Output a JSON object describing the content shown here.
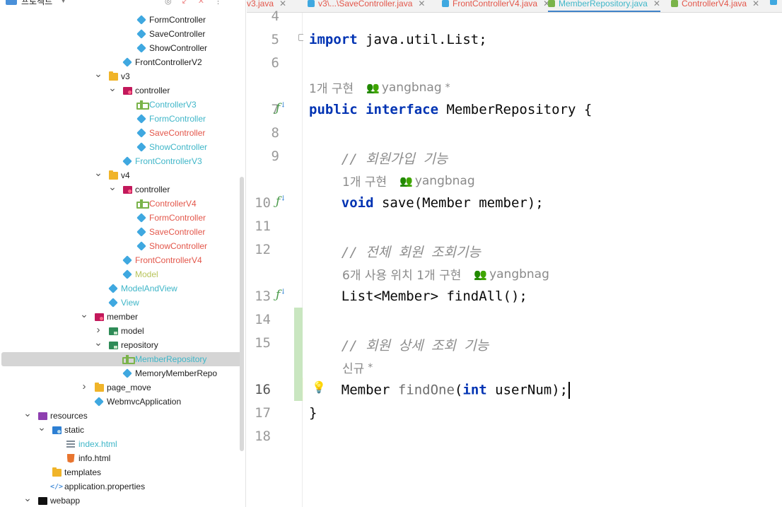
{
  "header": {
    "title": "프로젝트",
    "tools": [
      "◎",
      "↙",
      "✕",
      "⋮"
    ]
  },
  "tree": [
    {
      "label": "FormController",
      "depth": 10,
      "icon": "class",
      "color": "normal",
      "chev": ""
    },
    {
      "label": "SaveController",
      "depth": 10,
      "icon": "class",
      "color": "normal",
      "chev": ""
    },
    {
      "label": "ShowController",
      "depth": 10,
      "icon": "class",
      "color": "normal",
      "chev": ""
    },
    {
      "label": "FrontControllerV2",
      "depth": 9,
      "icon": "class",
      "color": "normal",
      "chev": ""
    },
    {
      "label": "v3",
      "depth": 8,
      "icon": "folder",
      "color": "normal",
      "chev": "open"
    },
    {
      "label": "controller",
      "depth": 9,
      "icon": "pkg-red",
      "color": "normal",
      "chev": "open"
    },
    {
      "label": "ControllerV3",
      "depth": 10,
      "icon": "interface",
      "color": "cyan",
      "chev": ""
    },
    {
      "label": "FormController",
      "depth": 10,
      "icon": "class",
      "color": "cyan",
      "chev": ""
    },
    {
      "label": "SaveController",
      "depth": 10,
      "icon": "class",
      "color": "red",
      "chev": ""
    },
    {
      "label": "ShowController",
      "depth": 10,
      "icon": "class",
      "color": "cyan",
      "chev": ""
    },
    {
      "label": "FrontControllerV3",
      "depth": 9,
      "icon": "class",
      "color": "cyan",
      "chev": ""
    },
    {
      "label": "v4",
      "depth": 8,
      "icon": "folder",
      "color": "normal",
      "chev": "open"
    },
    {
      "label": "controller",
      "depth": 9,
      "icon": "pkg-red",
      "color": "normal",
      "chev": "open"
    },
    {
      "label": "ControllerV4",
      "depth": 10,
      "icon": "interface",
      "color": "red",
      "chev": ""
    },
    {
      "label": "FormController",
      "depth": 10,
      "icon": "class",
      "color": "red",
      "chev": ""
    },
    {
      "label": "SaveController",
      "depth": 10,
      "icon": "class",
      "color": "red",
      "chev": ""
    },
    {
      "label": "ShowController",
      "depth": 10,
      "icon": "class",
      "color": "red",
      "chev": ""
    },
    {
      "label": "FrontControllerV4",
      "depth": 9,
      "icon": "class",
      "color": "red",
      "chev": ""
    },
    {
      "label": "Model",
      "depth": 9,
      "icon": "class",
      "color": "yellow",
      "chev": ""
    },
    {
      "label": "ModelAndView",
      "depth": 8,
      "icon": "class",
      "color": "cyan",
      "chev": ""
    },
    {
      "label": "View",
      "depth": 8,
      "icon": "class",
      "color": "cyan",
      "chev": ""
    },
    {
      "label": "member",
      "depth": 7,
      "icon": "pkg-red",
      "color": "normal",
      "chev": "open"
    },
    {
      "label": "model",
      "depth": 8,
      "icon": "pkg-green",
      "color": "normal",
      "chev": "closed"
    },
    {
      "label": "repository",
      "depth": 8,
      "icon": "pkg-green",
      "color": "normal",
      "chev": "open"
    },
    {
      "label": "MemberRepository",
      "depth": 9,
      "icon": "interface",
      "color": "cyan",
      "chev": "",
      "selected": true
    },
    {
      "label": "MemoryMemberRepo",
      "depth": 9,
      "icon": "class",
      "color": "normal",
      "chev": ""
    },
    {
      "label": "page_move",
      "depth": 7,
      "icon": "folder",
      "color": "normal",
      "chev": "closed"
    },
    {
      "label": "WebmvcApplication",
      "depth": 7,
      "icon": "class",
      "color": "normal",
      "chev": ""
    },
    {
      "label": "resources",
      "depth": 3,
      "icon": "pkg-purple",
      "color": "normal",
      "chev": "open"
    },
    {
      "label": "static",
      "depth": 4,
      "icon": "pkg-blue",
      "color": "normal",
      "chev": "open"
    },
    {
      "label": "index.html",
      "depth": 5,
      "icon": "html-lines",
      "color": "cyan",
      "chev": ""
    },
    {
      "label": "info.html",
      "depth": 5,
      "icon": "html5",
      "color": "normal",
      "chev": ""
    },
    {
      "label": "templates",
      "depth": 4,
      "icon": "folder",
      "color": "normal",
      "chev": ""
    },
    {
      "label": "application.properties",
      "depth": 4,
      "icon": "props",
      "color": "normal",
      "chev": ""
    },
    {
      "label": "webapp",
      "depth": 3,
      "icon": "pkg-black",
      "color": "normal",
      "chev": "open"
    }
  ],
  "tabs": [
    {
      "label": "v3.java",
      "style": "red",
      "active": false
    },
    {
      "label": "v3\\...\\SaveController.java",
      "style": "red",
      "active": false
    },
    {
      "label": "FrontControllerV4.java",
      "style": "red",
      "active": false
    },
    {
      "label": "MemberRepository.java",
      "style": "cyan",
      "active": true
    },
    {
      "label": "ControllerV4.java",
      "style": "red",
      "active": false
    }
  ],
  "editor": {
    "lines": [
      {
        "num": "4",
        "code": []
      },
      {
        "num": "5",
        "code": [
          [
            "kw",
            "import"
          ],
          [
            "",
            " java.util.List;"
          ]
        ]
      },
      {
        "num": "6",
        "code": []
      },
      {
        "num": "",
        "hint": {
          "text": "1개 구현",
          "author": "yangbnag",
          "star": "*"
        }
      },
      {
        "num": "7",
        "gutter": true,
        "code": [
          [
            "kw",
            "public interface"
          ],
          [
            "",
            " MemberRepository {"
          ]
        ]
      },
      {
        "num": "8",
        "code": []
      },
      {
        "num": "9",
        "code": [
          [
            "",
            "    "
          ],
          [
            "cmt",
            "// 회원가입 기능"
          ]
        ]
      },
      {
        "num": "",
        "hint": {
          "text": "1개 구현",
          "author": "yangbnag",
          "star": ""
        },
        "indent": true
      },
      {
        "num": "10",
        "gutter": true,
        "code": [
          [
            "",
            "    "
          ],
          [
            "kw",
            "void"
          ],
          [
            "",
            " save(Member member);"
          ]
        ]
      },
      {
        "num": "11",
        "code": []
      },
      {
        "num": "12",
        "code": [
          [
            "",
            "    "
          ],
          [
            "cmt",
            "// 전체 회원 조회기능"
          ]
        ]
      },
      {
        "num": "",
        "hint": {
          "text": "6개 사용 위치   1개 구현",
          "author": "yangbnag",
          "star": ""
        },
        "indent": true
      },
      {
        "num": "13",
        "gutter": true,
        "code": [
          [
            "",
            "    List<Member> findAll();"
          ]
        ]
      },
      {
        "num": "14",
        "code": []
      },
      {
        "num": "15",
        "code": [
          [
            "",
            "    "
          ],
          [
            "cmt",
            "// 회원 상세 조회 기능"
          ]
        ]
      },
      {
        "num": "",
        "hint": {
          "text": "신규",
          "author": "",
          "star": "*"
        },
        "indent": true
      },
      {
        "num": "16",
        "current": true,
        "code": [
          [
            "",
            "    Member "
          ],
          [
            "fn-gray",
            "findOne"
          ],
          [
            "",
            "("
          ],
          [
            "kw",
            "int"
          ],
          [
            "",
            " userNum);"
          ]
        ]
      },
      {
        "num": "17",
        "code": [
          [
            "",
            "}"
          ]
        ]
      },
      {
        "num": "18",
        "code": []
      }
    ]
  }
}
